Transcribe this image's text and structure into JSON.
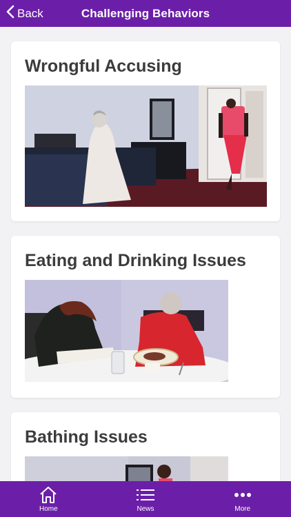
{
  "header": {
    "back_label": "Back",
    "title": "Challenging Behaviors"
  },
  "cards": [
    {
      "title": "Wrongful Accusing"
    },
    {
      "title": "Eating and Drinking Issues"
    },
    {
      "title": "Bathing Issues"
    }
  ],
  "tabbar": {
    "items": [
      {
        "label": "Home",
        "icon": "home-icon"
      },
      {
        "label": "News",
        "icon": "list-icon"
      },
      {
        "label": "More",
        "icon": "more-dots-icon"
      }
    ]
  },
  "colors": {
    "accent": "#6b1fa8",
    "background": "#f2f2f4",
    "card": "#ffffff",
    "title_text": "#3c3c3c"
  }
}
